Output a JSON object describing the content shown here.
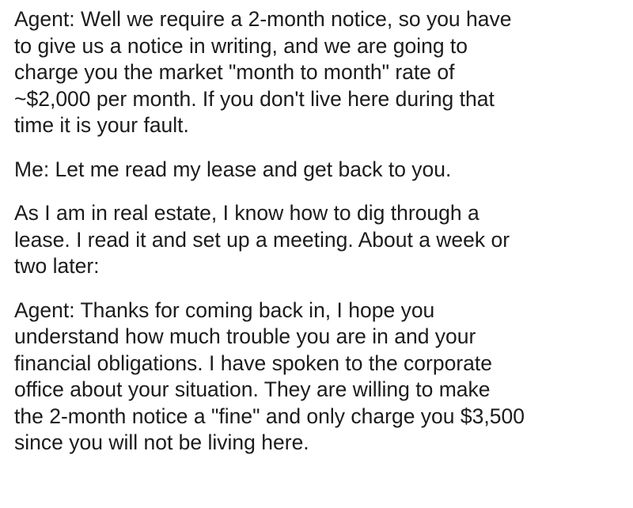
{
  "paragraphs": [
    {
      "lines": [
        "Agent: Well we require a 2-month notice, so you have",
        "to give us a notice in writing, and we are going to",
        "charge you the market \"month to month\" rate of",
        "~$2,000 per month.  If you don't live here during that",
        "time it is your fault."
      ]
    },
    {
      "lines": [
        "Me:  Let me read my lease and get back to you."
      ]
    },
    {
      "lines": [
        "As I am in real estate, I know how to dig through a",
        "lease.  I read it and set up a meeting.  About a week or",
        "two later:"
      ]
    },
    {
      "lines": [
        "Agent:  Thanks for coming back in, I hope you",
        "understand how much trouble you are in and your",
        "financial obligations.  I have spoken to the corporate",
        "office about your situation.  They are willing to make",
        "the 2-month notice a \"fine\" and only charge you $3,500",
        "since you will not be living here."
      ]
    }
  ]
}
